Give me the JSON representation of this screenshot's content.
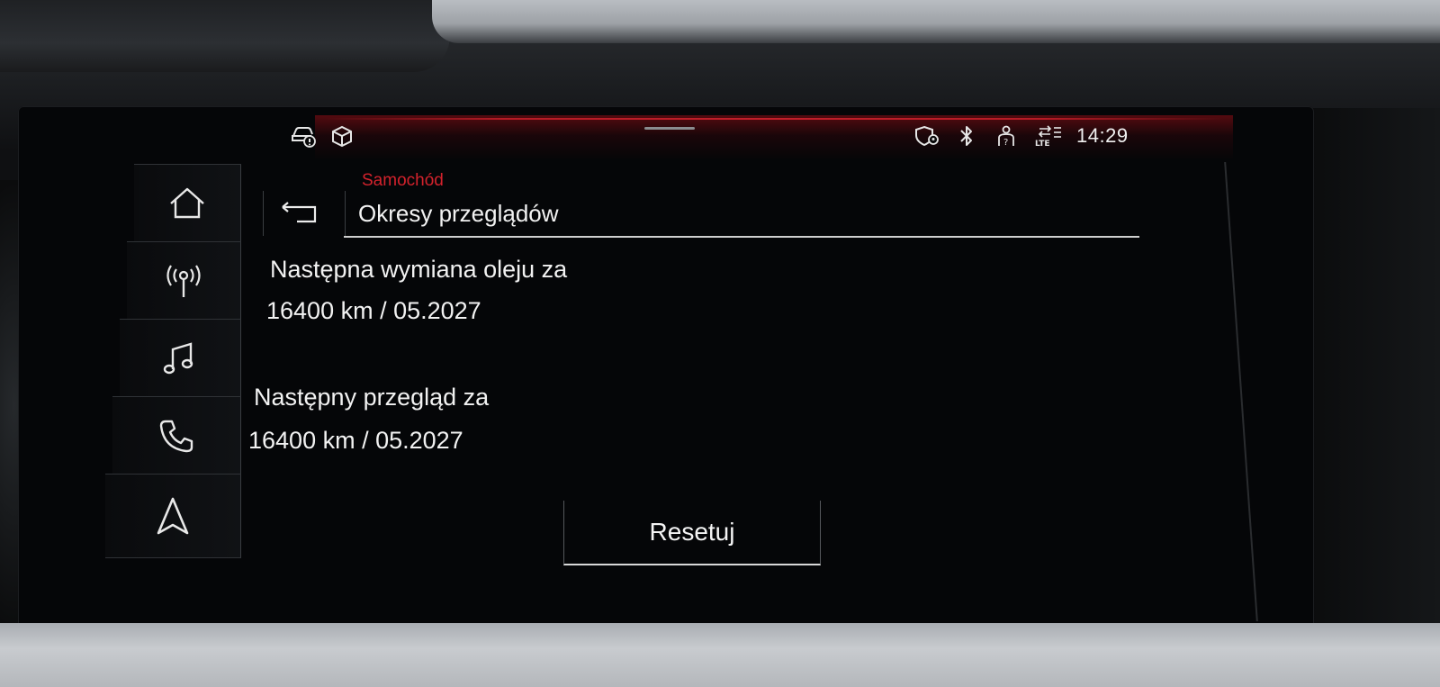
{
  "status_bar": {
    "left_icons": [
      "car-info-icon",
      "package-icon"
    ],
    "right_icons": [
      "shield-location-icon",
      "bluetooth-icon",
      "person-help-icon",
      "lte-data-icon"
    ],
    "time": "14:29"
  },
  "sidebar": {
    "items": [
      {
        "icon": "home-icon"
      },
      {
        "icon": "radio-icon"
      },
      {
        "icon": "music-icon"
      },
      {
        "icon": "phone-icon"
      },
      {
        "icon": "navigation-icon"
      }
    ]
  },
  "header": {
    "breadcrumb": "Samochód",
    "title": "Okresy przeglądów"
  },
  "content": {
    "oil_change_label": "Następna wymiana oleju za",
    "oil_change_value": "16400 km / 05.2027",
    "inspection_label": "Następny przegląd za",
    "inspection_value": "16400 km / 05.2027"
  },
  "actions": {
    "reset_label": "Resetuj"
  },
  "colors": {
    "accent_red": "#d3222c",
    "text": "#f2f2f2",
    "background": "#050608"
  }
}
